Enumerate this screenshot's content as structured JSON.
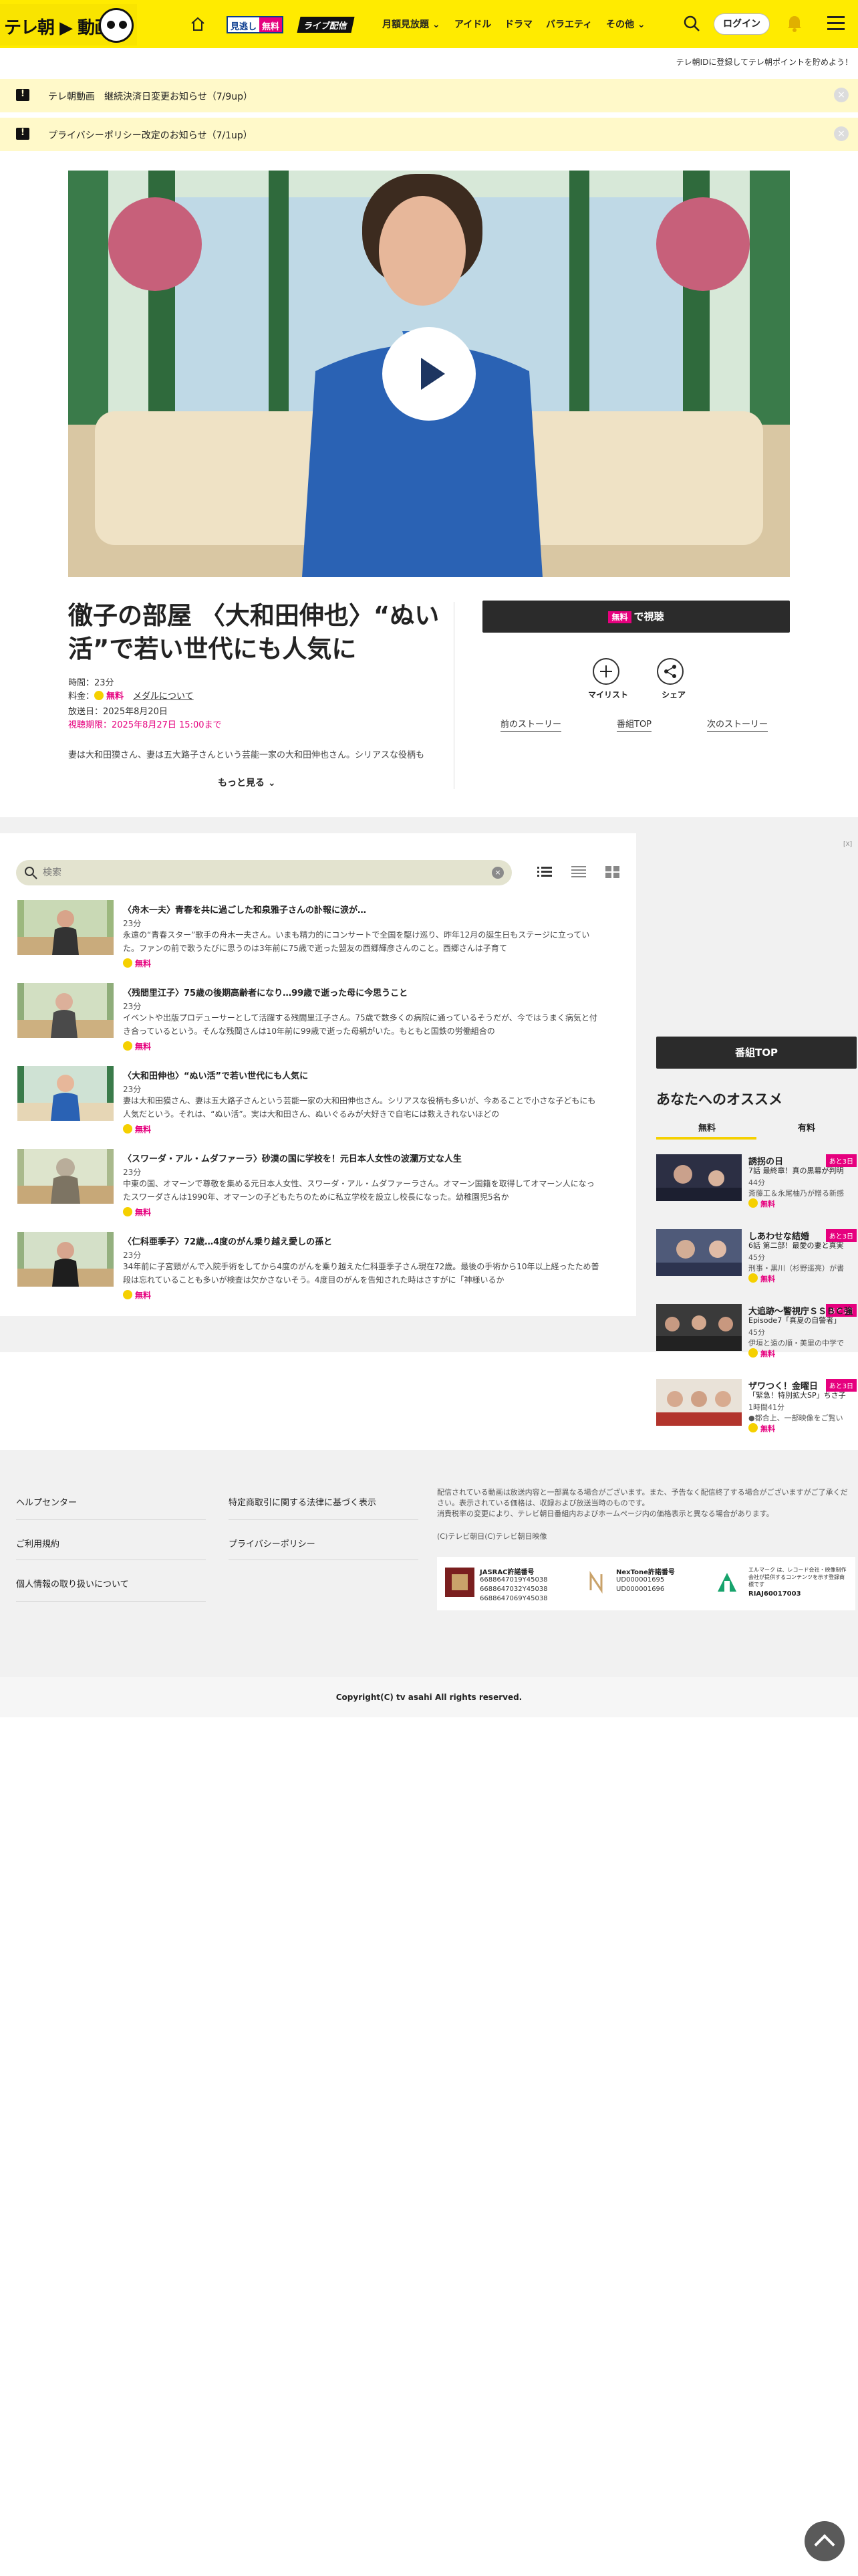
{
  "header": {
    "logo_text": "テレ朝",
    "logo_text2": "動画",
    "miss_label": "見逃し",
    "miss_free": "無料",
    "live_label": "ライブ配信",
    "nav": [
      "月額見放題",
      "アイドル",
      "ドラマ",
      "バラエティ",
      "その他"
    ],
    "login": "ログイン",
    "promo": "テレ朝IDに登録してテレ朝ポイントを貯めよう！"
  },
  "notices": [
    "テレ朝動画　継続決済日変更お知らせ（7/9up）",
    "プライバシーポリシー改定のお知らせ（7/1up）"
  ],
  "program": {
    "title": "徹子の部屋 〈大和田伸也〉“ぬい活”で若い世代にも人気に",
    "duration": "時間：23分",
    "price_label": "料金：",
    "price": "無料",
    "medal_link": "メダルについて",
    "air_date": "放送日：2025年8月20日",
    "deadline": "視聴期限：2025年8月27日 15:00まで",
    "description": "妻は大和田獏さん、妻は五大路子さんという芸能一家の大和田伸也さん。シリアスな役柄も",
    "more": "もっと見る",
    "watch_free": "無料",
    "watch_label": "で視聴",
    "mylist": "マイリスト",
    "share": "シェア",
    "prev_story": "前のストーリー",
    "program_top": "番組TOP",
    "next_story": "次のストーリー"
  },
  "episodes_panel": {
    "search_placeholder": "検索",
    "clear": "×",
    "free_label": "無料",
    "items": [
      {
        "title": "〈舟木一夫〉青春を共に過ごした和泉雅子さんの訃報に涙が…",
        "duration": "23分",
        "desc": "永遠の“青春スター”歌手の舟木一夫さん。いまも精力的にコンサートで全国を駆け巡り、昨年12月の誕生日もステージに立っていた。ファンの前で歌うたびに思うのは3年前に75歳で逝った盟友の西郷輝彦さんのこと。西郷さんは子育て"
      },
      {
        "title": "〈残間里江子〉75歳の後期高齢者になり…99歳で逝った母に今思うこと",
        "duration": "23分",
        "desc": "イベントや出版プロデューサーとして活躍する残間里江子さん。75歳で数多くの病院に通っているそうだが、今ではうまく病気と付き合っているという。そんな残間さんは10年前に99歳で逝った母親がいた。もともと国鉄の労働組合の"
      },
      {
        "title": "〈大和田伸也〉“ぬい活”で若い世代にも人気に",
        "duration": "23分",
        "desc": "妻は大和田獏さん、妻は五大路子さんという芸能一家の大和田伸也さん。シリアスな役柄も多いが、今あることで小さな子どもにも人気だという。それは、“ぬい活”。実は大和田さん、ぬいぐるみが大好きで自宅には数えきれないほどの"
      },
      {
        "title": "〈スワーダ・アル・ムダファーラ〉砂漠の国に学校を！元日本人女性の波瀾万丈な人生",
        "duration": "23分",
        "desc": "中東の国、オマーンで尊敬を集める元日本人女性、スワーダ・アル・ムダファーラさん。オマーン国籍を取得してオマーン人になったスワーダさんは1990年、オマーンの子どもたちのために私立学校を設立し校長になった。幼稚園児5名か"
      },
      {
        "title": "〈仁科亜季子〉72歳…4度のがん乗り越え愛しの孫と",
        "duration": "23分",
        "desc": "34年前に子宮頸がんで入院手術をしてから4度のがんを乗り越えた仁科亜季子さん現在72歳。最後の手術から10年以上経ったため普段は忘れていることも多いが検査は欠かさないそう。4度目のがんを告知された時はさすがに「神様いるか"
      }
    ]
  },
  "sidebar": {
    "program_top": "番組TOP",
    "rec_title": "あなたへのオススメ",
    "tab_free": "無料",
    "tab_paid": "有料",
    "tag": "あと3日",
    "free_label": "無料",
    "items": [
      {
        "name": "誘拐の日",
        "sub": "7話 最終章！真の黒幕が判明",
        "duration": "44分",
        "desc": "斎藤工＆永尾柚乃が贈る新感"
      },
      {
        "name": "しあわせな結婚",
        "sub": "6話 第二部！最愛の妻と真実",
        "duration": "45分",
        "desc": "刑事・黒川（杉野遥亮）が書"
      },
      {
        "name": "大追跡～警視庁ＳＳＢＣ強",
        "sub": "Episode7「真夏の自警者」",
        "duration": "45分",
        "desc": "伊垣と遠の順・美里の中学で"
      },
      {
        "name": "ザワつく！金曜日",
        "sub": "「緊急！特別拡大SP」ちさ子",
        "duration": "1時間41分",
        "desc": "●都合上、一部映像をご覧い"
      }
    ]
  },
  "footer": {
    "links": [
      "ヘルプセンター",
      "特定商取引に関する法律に基づく表示",
      "ご利用規約",
      "プライバシーポリシー",
      "個人情報の取り扱いについて"
    ],
    "note1": "配信されている動画は放送内容と一部異なる場合がございます。また、予告なく配信終了する場合がございますがご了承ください。表示されている価格は、収録および放送当時のものです。",
    "note2": "消費税率の変更により、テレビ朝日番組内およびホームページ内の価格表示と異なる場合があります。",
    "note3": "(C)テレビ朝日(C)テレビ朝日映像",
    "jasrac_name": "JASRAC許諾番号",
    "jasrac_nums": [
      "6688647019Y45038",
      "6688647032Y45038",
      "6688647069Y45038"
    ],
    "nextone_name": "NexTone許諾番号",
    "nextone_nums": [
      "UD000001695",
      "UD000001696"
    ],
    "riaj_text": "エルマーク は、レコード会社・映像制作会社が提供するコンテンツを示す登録商標です",
    "riaj_num": "RIAJ60017003",
    "copyright": "Copyright(C) tv asahi All rights reserved."
  },
  "colors": {
    "brand_yellow": "#ffeb00",
    "accent_pink": "#e6007e",
    "dark_button": "#2b2b2b"
  }
}
